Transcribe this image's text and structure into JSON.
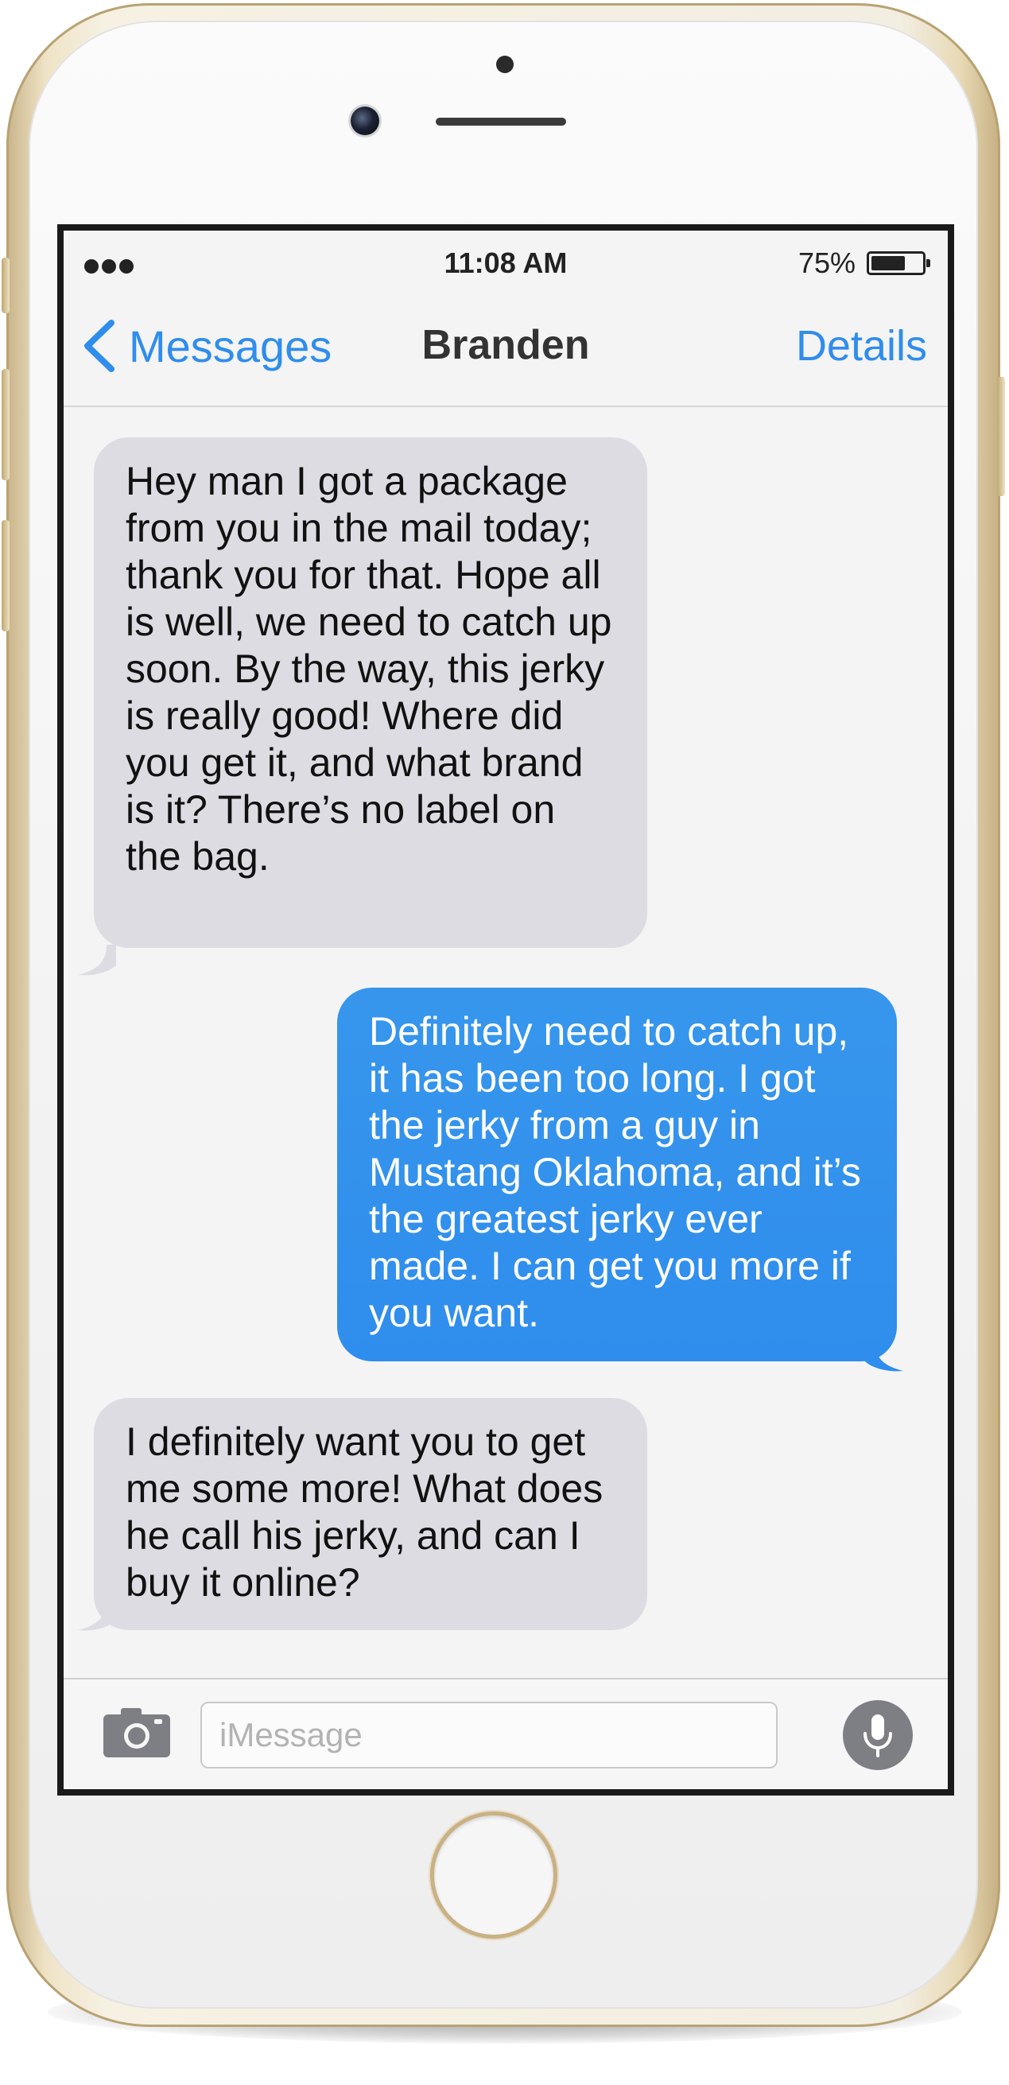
{
  "status_bar": {
    "time": "11:08 AM",
    "battery_percent": "75%",
    "battery_level": 0.75,
    "signal_icon": "signal-dots-icon"
  },
  "nav": {
    "back_label": "Messages",
    "title": "Branden",
    "details_label": "Details"
  },
  "messages": [
    {
      "direction": "received",
      "text": "Hey man I got a package from you in the mail today; thank you for that. Hope all is well, we need to catch up soon. By the way, this jerky is really good! Where did you get it, and what brand is it? There’s no label on the bag."
    },
    {
      "direction": "sent",
      "text": "Definitely need to catch up, it has been too long. I got the jerky from a guy in Mustang Oklahoma, and it’s the greatest jerky ever made. I can get you more if you want."
    },
    {
      "direction": "received",
      "text": "I definitely want you to get me some more! What does he call his jerky, and can I buy it online?"
    }
  ],
  "input_bar": {
    "placeholder": "iMessage",
    "value": ""
  },
  "colors": {
    "accent": "#2f8ded",
    "received_bubble": "#dcdce2",
    "sent_bubble": "#2f8ded",
    "phone_frame": "#c9b48a"
  }
}
